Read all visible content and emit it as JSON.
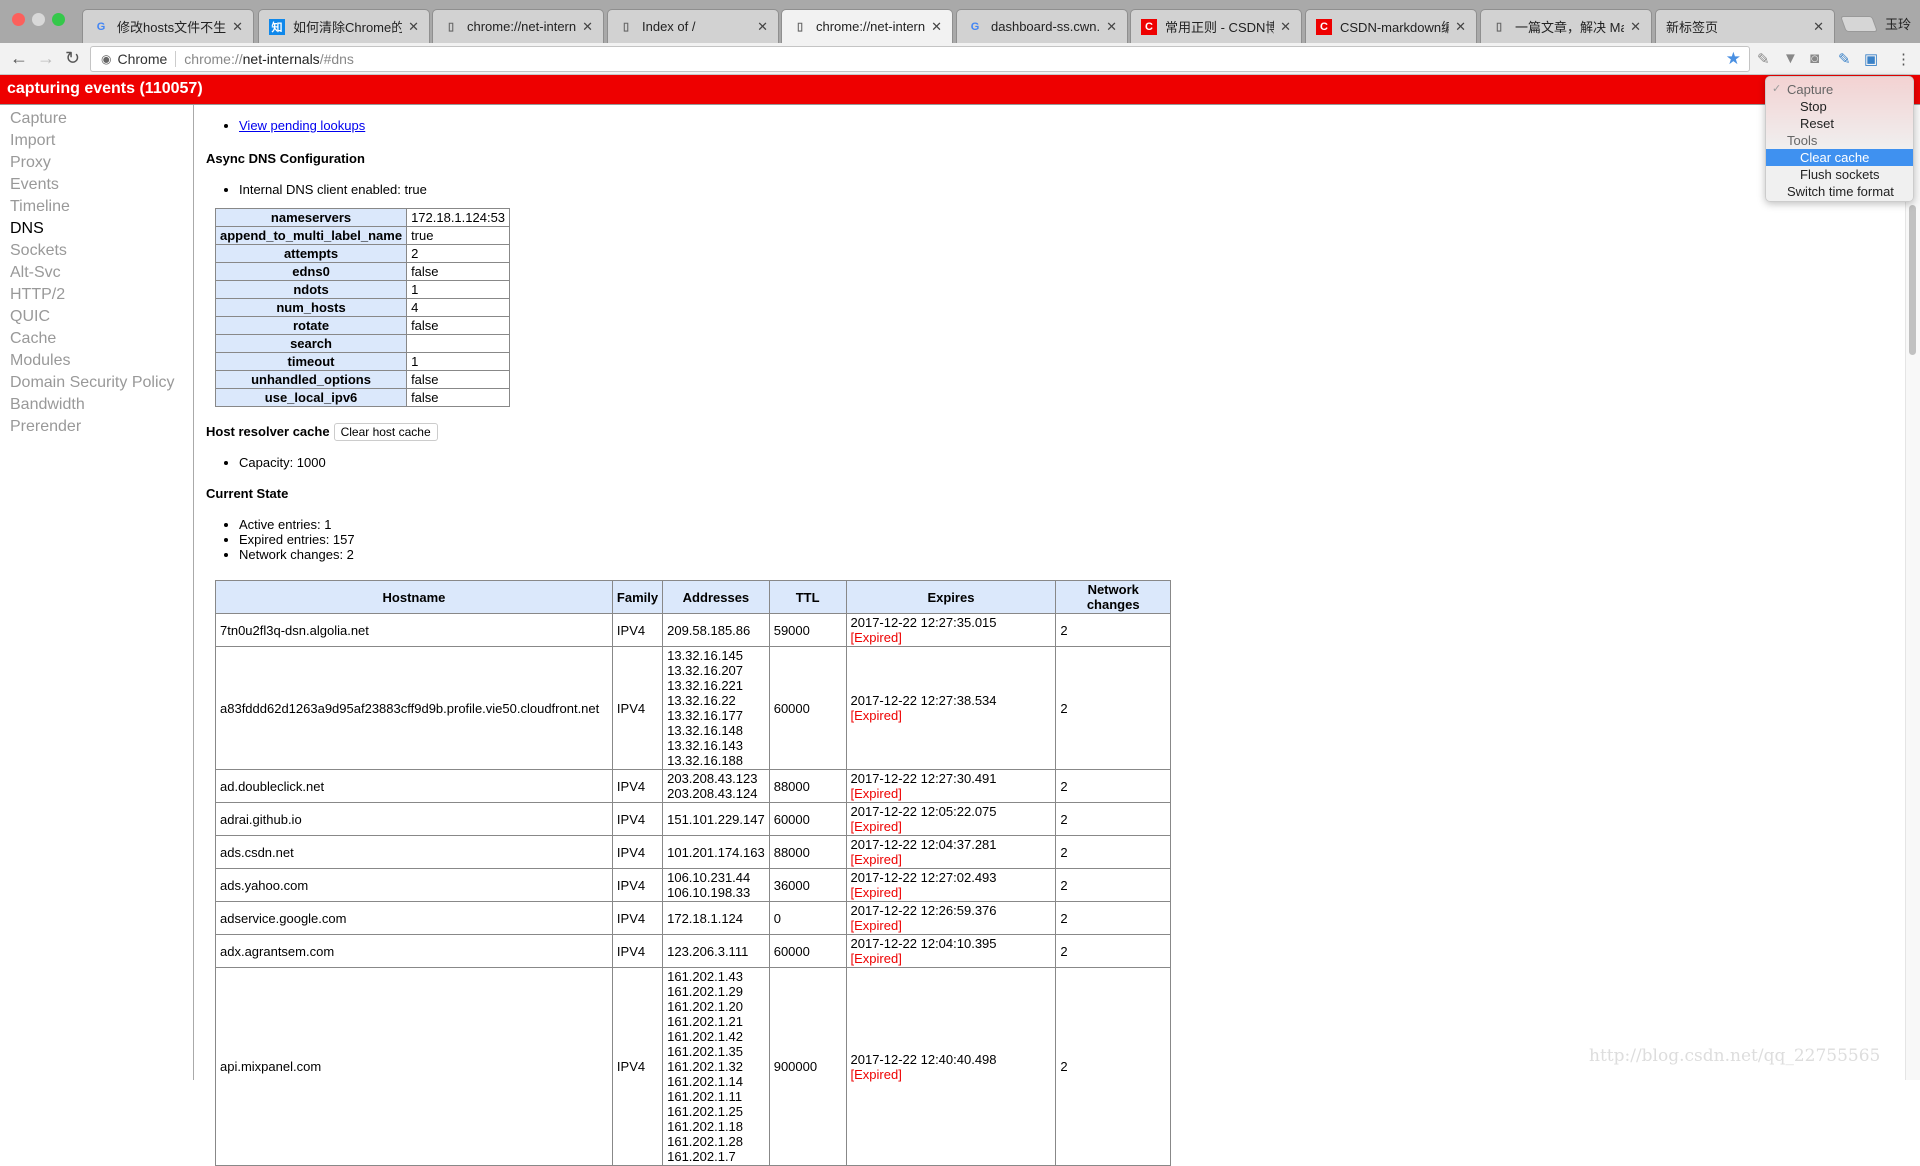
{
  "browser": {
    "tabs": [
      {
        "title": "修改hosts文件不生效",
        "icon": "google-icon"
      },
      {
        "title": "如何清除Chrome的dns",
        "icon": "zhihu-icon",
        "icon_text": "知"
      },
      {
        "title": "chrome://net-internals",
        "icon": "page-icon"
      },
      {
        "title": "Index of /",
        "icon": "page-icon"
      },
      {
        "title": "chrome://net-internals",
        "icon": "page-icon",
        "active": true
      },
      {
        "title": "dashboard-ss.cwn.ba",
        "icon": "google-icon"
      },
      {
        "title": "常用正则 - CSDN博客",
        "icon": "csdn-icon",
        "icon_text": "C"
      },
      {
        "title": "CSDN-markdown编辑",
        "icon": "csdn-icon",
        "icon_text": "C"
      },
      {
        "title": "一篇文章，解决 Mac",
        "icon": "page-icon"
      },
      {
        "title": "新标签页",
        "icon": ""
      }
    ],
    "profile_name": "玉玲",
    "omnibox": {
      "site_label": "Chrome",
      "scheme": "chrome://",
      "host": "net-internals",
      "path": "/#dns"
    }
  },
  "capture_bar": {
    "text": "capturing events (110057)"
  },
  "sidebar": {
    "items": [
      "Capture",
      "Import",
      "Proxy",
      "Events",
      "Timeline",
      "DNS",
      "Sockets",
      "Alt-Svc",
      "HTTP/2",
      "QUIC",
      "Cache",
      "Modules",
      "Domain Security Policy",
      "Bandwidth",
      "Prerender"
    ],
    "selected": "DNS"
  },
  "dns": {
    "pending_link": "View pending lookups",
    "async_title": "Async DNS Configuration",
    "internal_client": "Internal DNS client enabled: true",
    "config": [
      [
        "nameservers",
        "172.18.1.124:53"
      ],
      [
        "append_to_multi_label_name",
        "true"
      ],
      [
        "attempts",
        "2"
      ],
      [
        "edns0",
        "false"
      ],
      [
        "ndots",
        "1"
      ],
      [
        "num_hosts",
        "4"
      ],
      [
        "rotate",
        "false"
      ],
      [
        "search",
        ""
      ],
      [
        "timeout",
        "1"
      ],
      [
        "unhandled_options",
        "false"
      ],
      [
        "use_local_ipv6",
        "false"
      ]
    ],
    "host_cache_title": "Host resolver cache",
    "clear_host_cache": "Clear host cache",
    "capacity": "Capacity: 1000",
    "current_state_title": "Current State",
    "state": [
      "Active entries: 1",
      "Expired entries: 157",
      "Network changes: 2"
    ],
    "columns": [
      "Hostname",
      "Family",
      "Addresses",
      "TTL",
      "Expires",
      "Network changes"
    ],
    "expired_label": "[Expired]",
    "rows": [
      {
        "host": "7tn0u2fl3q-dsn.algolia.net",
        "family": "IPV4",
        "addresses": [
          "209.58.185.86"
        ],
        "ttl": "59000",
        "expires": "2017-12-22 12:27:35.015",
        "changes": "2"
      },
      {
        "host": "a83fddd62d1263a9d95af23883cff9d9b.profile.vie50.cloudfront.net",
        "family": "IPV4",
        "addresses": [
          "13.32.16.145",
          "13.32.16.207",
          "13.32.16.221",
          "13.32.16.22",
          "13.32.16.177",
          "13.32.16.148",
          "13.32.16.143",
          "13.32.16.188"
        ],
        "ttl": "60000",
        "expires": "2017-12-22 12:27:38.534",
        "changes": "2"
      },
      {
        "host": "ad.doubleclick.net",
        "family": "IPV4",
        "addresses": [
          "203.208.43.123",
          "203.208.43.124"
        ],
        "ttl": "88000",
        "expires": "2017-12-22 12:27:30.491",
        "changes": "2"
      },
      {
        "host": "adrai.github.io",
        "family": "IPV4",
        "addresses": [
          "151.101.229.147"
        ],
        "ttl": "60000",
        "expires": "2017-12-22 12:05:22.075",
        "changes": "2"
      },
      {
        "host": "ads.csdn.net",
        "family": "IPV4",
        "addresses": [
          "101.201.174.163"
        ],
        "ttl": "88000",
        "expires": "2017-12-22 12:04:37.281",
        "changes": "2"
      },
      {
        "host": "ads.yahoo.com",
        "family": "IPV4",
        "addresses": [
          "106.10.231.44",
          "106.10.198.33"
        ],
        "ttl": "36000",
        "expires": "2017-12-22 12:27:02.493",
        "changes": "2"
      },
      {
        "host": "adservice.google.com",
        "family": "IPV4",
        "addresses": [
          "172.18.1.124"
        ],
        "ttl": "0",
        "expires": "2017-12-22 12:26:59.376",
        "changes": "2"
      },
      {
        "host": "adx.agrantsem.com",
        "family": "IPV4",
        "addresses": [
          "123.206.3.111"
        ],
        "ttl": "60000",
        "expires": "2017-12-22 12:04:10.395",
        "changes": "2"
      },
      {
        "host": "api.mixpanel.com",
        "family": "IPV4",
        "addresses": [
          "161.202.1.43",
          "161.202.1.29",
          "161.202.1.20",
          "161.202.1.21",
          "161.202.1.42",
          "161.202.1.35",
          "161.202.1.32",
          "161.202.1.14",
          "161.202.1.11",
          "161.202.1.25",
          "161.202.1.18",
          "161.202.1.28",
          "161.202.1.7"
        ],
        "ttl": "900000",
        "expires": "2017-12-22 12:40:40.498",
        "changes": "2"
      }
    ]
  },
  "menu": {
    "items": [
      {
        "label": "Capture",
        "checked": true,
        "style": "header"
      },
      {
        "label": "Stop",
        "style": "indent"
      },
      {
        "label": "Reset",
        "style": "indent"
      },
      {
        "label": "Tools",
        "style": "header"
      },
      {
        "label": "Clear cache",
        "style": "indent",
        "highlighted": true
      },
      {
        "label": "Flush sockets",
        "style": "indent"
      },
      {
        "label": "Switch time format",
        "style": "header"
      }
    ]
  },
  "watermark": "http://blog.csdn.net/qq_22755565",
  "colors": {
    "capture_bar": "#ee0000",
    "header_cell": "#dbe8fb",
    "expired": "#ee0000",
    "menu_highlight": "#3f91f0"
  }
}
